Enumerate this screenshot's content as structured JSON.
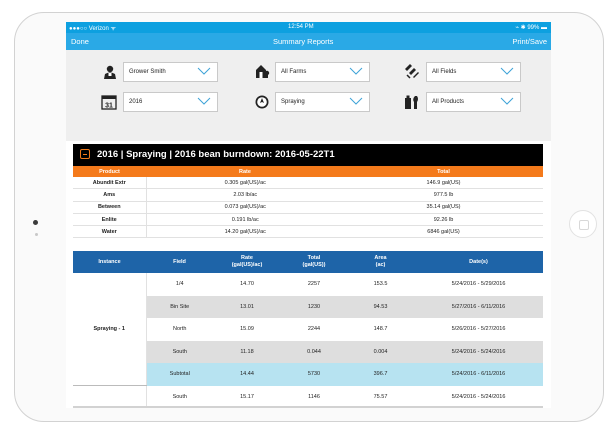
{
  "status_bar": {
    "carrier": "●●●○○ Verizon ᯤ",
    "time": "12:54 PM",
    "battery": "⌁ ✱ 99% ▬"
  },
  "navbar": {
    "done": "Done",
    "title": "Summary Reports",
    "print": "Print/Save"
  },
  "filters": {
    "grower": "Grower Smith",
    "farms": "All Farms",
    "fields": "All Fields",
    "year": "2016",
    "year_icon": "31",
    "operation": "Spraying",
    "products": "All Products"
  },
  "icons": {
    "grower": "person-icon",
    "farms": "barn-icon",
    "fields": "field-icon",
    "year": "calendar-icon",
    "operation": "compass-icon",
    "products": "product-icon",
    "chevron": "chevron-down-icon"
  },
  "colors": {
    "accent": "#2aa9e6",
    "orange": "#f47a1b",
    "blue": "#1e64a8"
  },
  "report": {
    "title": "2016 | Spraying | 2016 bean burndown: 2016-05-22T1",
    "product_headers": [
      "Product",
      "Rate",
      "Total"
    ],
    "products": [
      {
        "name": "Abundit Extr",
        "rate": "0.305 gal(US)/ac",
        "total": "146.9 gal(US)"
      },
      {
        "name": "Ams",
        "rate": "2.03 lb/ac",
        "total": "977.5 lb"
      },
      {
        "name": "Between",
        "rate": "0.073 gal(US)/ac",
        "total": "35.14 gal(US)"
      },
      {
        "name": "Enlite",
        "rate": "0.191 lb/ac",
        "total": "92.26 lb"
      },
      {
        "name": "Water",
        "rate": "14.20 gal(US)/ac",
        "total": "6846 gal(US)"
      }
    ],
    "instance_headers": {
      "instance": "Instance",
      "field": "Field",
      "rate": "Rate",
      "rate_unit": "(gal(US)/ac)",
      "total": "Total",
      "total_unit": "(gal(US))",
      "area": "Area",
      "area_unit": "(ac)",
      "dates": "Date(s)"
    },
    "instance_name": "Spraying - 1",
    "rows": [
      {
        "field": "1/4",
        "rate": "14.70",
        "total": "2257",
        "area": "153.5",
        "dates": "5/24/2016 - 5/29/2016"
      },
      {
        "field": "Bin Site",
        "rate": "13.01",
        "total": "1230",
        "area": "94.53",
        "dates": "5/27/2016 - 6/11/2016"
      },
      {
        "field": "North",
        "rate": "15.09",
        "total": "2244",
        "area": "148.7",
        "dates": "5/26/2016 - 5/27/2016"
      },
      {
        "field": "South",
        "rate": "11.18",
        "total": "0.044",
        "area": "0.004",
        "dates": "5/24/2016 - 5/24/2016"
      },
      {
        "field": "Subtotal",
        "rate": "14.44",
        "total": "5730",
        "area": "396.7",
        "dates": "5/24/2016 - 6/11/2016"
      },
      {
        "field": "South",
        "rate": "15.17",
        "total": "1146",
        "area": "75.57",
        "dates": "5/24/2016 - 5/24/2016"
      }
    ]
  }
}
